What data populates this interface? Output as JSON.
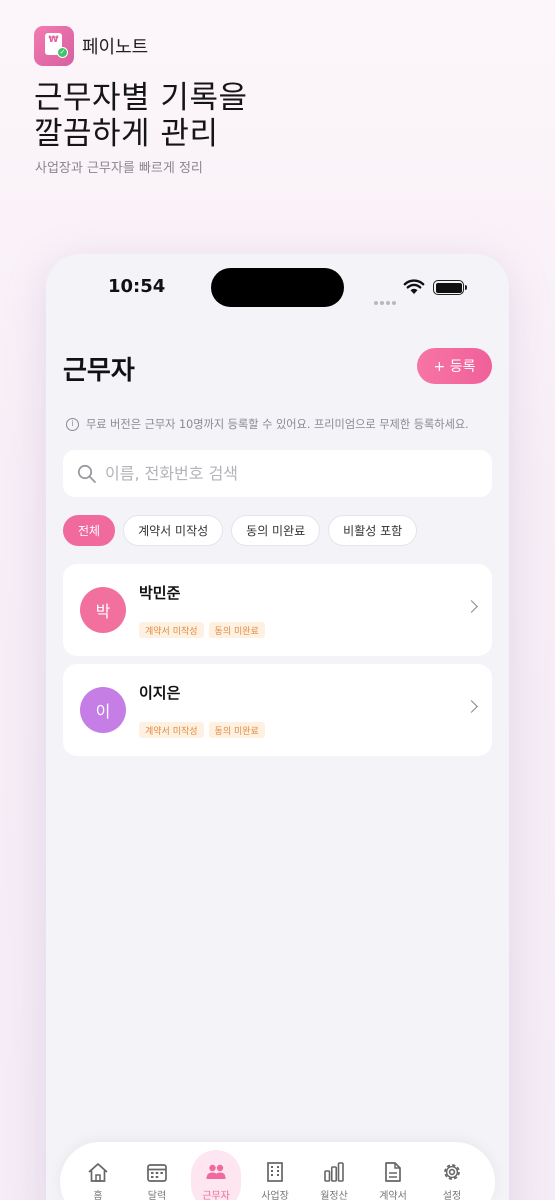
{
  "brand": {
    "name": "페이노트",
    "icon_glyph": "₩",
    "icon": "app-document-check-icon"
  },
  "headline": {
    "line1": "근무자별 기록을",
    "line2": "깔끔하게 관리"
  },
  "subline": "사업장과 근무자를 빠르게 정리",
  "status_bar": {
    "time": "10:54"
  },
  "screen": {
    "title": "근무자",
    "register_button": "+ 등록",
    "notice": "무료 버전은 근무자 10명까지 등록할 수 있어요. 프리미엄으로 무제한 등록하세요.",
    "search": {
      "placeholder": "이름, 전화번호 검색",
      "value": ""
    },
    "filters": [
      {
        "label": "전체",
        "active": true
      },
      {
        "label": "계약서 미작성",
        "active": false
      },
      {
        "label": "동의 미완료",
        "active": false
      },
      {
        "label": "비활성 포함",
        "active": false
      }
    ],
    "workers": [
      {
        "initial": "박",
        "name": "박민준",
        "avatar_color": "#f2709d",
        "badges": [
          "계약서 미작성",
          "동의 미완료"
        ]
      },
      {
        "initial": "이",
        "name": "이지은",
        "avatar_color": "#c57ee6",
        "badges": [
          "계약서 미작성",
          "동의 미완료"
        ]
      }
    ]
  },
  "tabbar": {
    "active": "근무자",
    "items": [
      {
        "label": "홈",
        "icon": "home-icon"
      },
      {
        "label": "달력",
        "icon": "calendar-icon"
      },
      {
        "label": "근무자",
        "icon": "people-icon"
      },
      {
        "label": "사업장",
        "icon": "building-icon"
      },
      {
        "label": "월정산",
        "icon": "bar-chart-icon"
      },
      {
        "label": "계약서",
        "icon": "document-icon"
      },
      {
        "label": "설정",
        "icon": "gear-icon"
      }
    ]
  },
  "colors": {
    "accent": "#f06a9d",
    "badge_bg": "#fff1e2",
    "badge_text": "#e28b3e"
  }
}
